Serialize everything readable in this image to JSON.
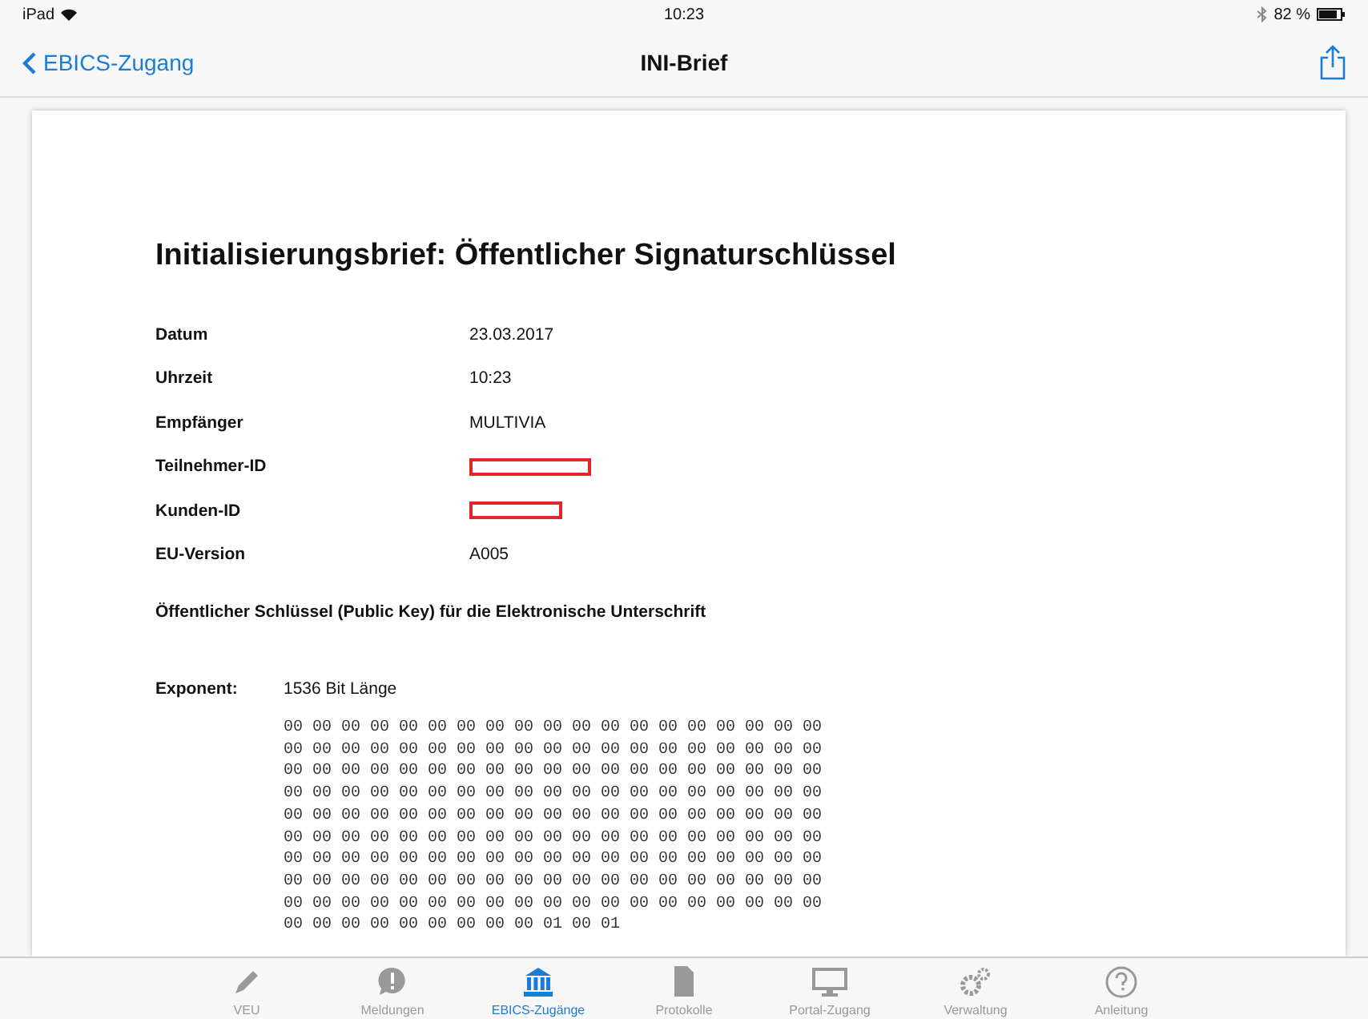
{
  "status_bar": {
    "device": "iPad",
    "time": "10:23",
    "battery": "82 %"
  },
  "nav_bar": {
    "back": "EBICS-Zugang",
    "title": "INI-Brief"
  },
  "letter": {
    "title": "Initialisierungsbrief: Öffentlicher Signaturschlüssel",
    "fields": [
      {
        "label": "Datum",
        "kind": "text",
        "value": "23.03.2017"
      },
      {
        "label": "Uhrzeit",
        "kind": "text",
        "value": "10:23"
      },
      {
        "label": "Empfänger",
        "kind": "text",
        "value": "MULTIVIA"
      },
      {
        "label": "Teilnehmer-ID",
        "kind": "redacted"
      },
      {
        "label": "Kunden-ID",
        "kind": "redacted"
      },
      {
        "label": "EU-Version",
        "kind": "text",
        "value": "A005"
      }
    ],
    "subheading": "Öffentlicher Schlüssel (Public Key) für die Elektronische Unterschrift",
    "exponent_label": "Exponent:",
    "exponent_value": "1536 Bit Länge",
    "hex_lines": [
      "00 00 00 00 00 00 00 00 00 00 00 00 00 00 00 00 00 00 00",
      "00 00 00 00 00 00 00 00 00 00 00 00 00 00 00 00 00 00 00",
      "00 00 00 00 00 00 00 00 00 00 00 00 00 00 00 00 00 00 00",
      "00 00 00 00 00 00 00 00 00 00 00 00 00 00 00 00 00 00 00",
      "00 00 00 00 00 00 00 00 00 00 00 00 00 00 00 00 00 00 00",
      "00 00 00 00 00 00 00 00 00 00 00 00 00 00 00 00 00 00 00",
      "00 00 00 00 00 00 00 00 00 00 00 00 00 00 00 00 00 00 00",
      "00 00 00 00 00 00 00 00 00 00 00 00 00 00 00 00 00 00 00",
      "00 00 00 00 00 00 00 00 00 00 00 00 00 00 00 00 00 00 00",
      "00 00 00 00 00 00 00 00 00 01 00 01"
    ]
  },
  "tab_bar": [
    {
      "label": "VEU",
      "kind": "pencil",
      "selected": false
    },
    {
      "label": "Meldungen",
      "kind": "alert",
      "selected": false
    },
    {
      "label": "EBICS-Zugänge",
      "kind": "bank",
      "selected": true
    },
    {
      "label": "Protokolle",
      "kind": "document",
      "selected": false
    },
    {
      "label": "Portal-Zugang",
      "kind": "monitor",
      "selected": false
    },
    {
      "label": "Verwaltung",
      "kind": "gears",
      "selected": false
    },
    {
      "label": "Anleitung",
      "kind": "help",
      "selected": false
    }
  ]
}
